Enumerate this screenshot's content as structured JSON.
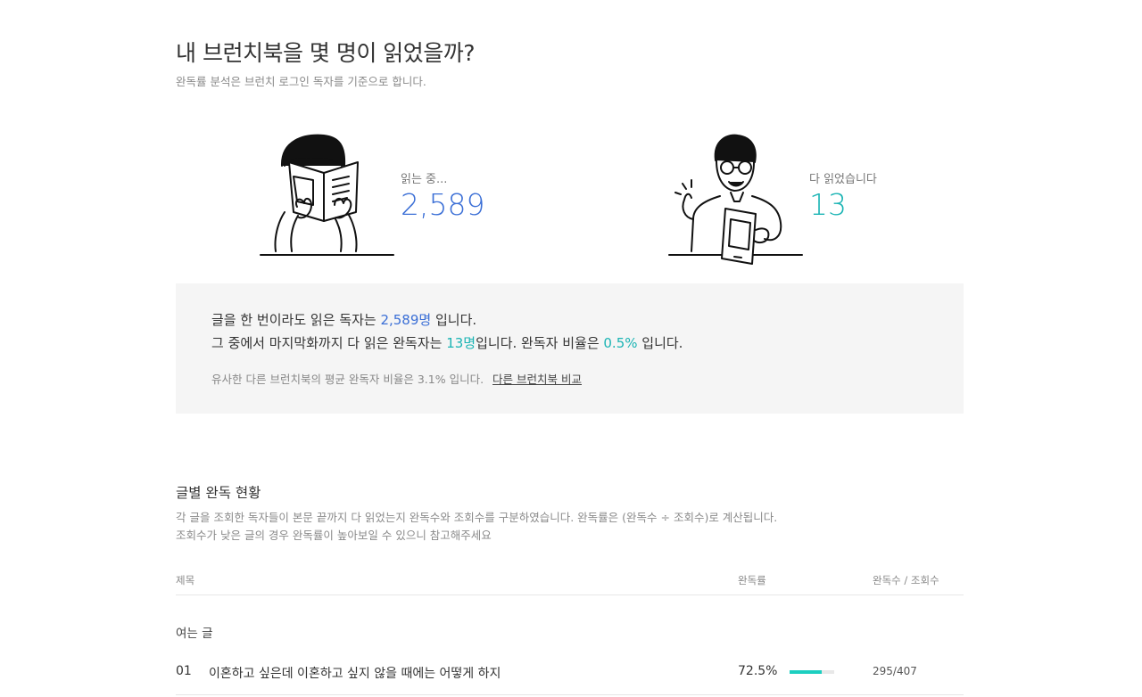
{
  "header": {
    "title": "내 브런치북을 몇 명이 읽었을까?",
    "subtitle": "완독률 분석은 브런치 로그인 독자를 기준으로 합니다."
  },
  "stats": {
    "reading": {
      "label": "읽는 중...",
      "value": "2,589",
      "color": "#3b6fd6"
    },
    "finished": {
      "label": "다 읽었습니다",
      "value": "13",
      "color": "#1ab4b4"
    }
  },
  "summary": {
    "line1_prefix": "글을 한 번이라도 읽은 독자는 ",
    "line1_value": "2,589명",
    "line1_suffix": " 입니다.",
    "line2_prefix": "그 중에서 마지막화까지 다 읽은 완독자는 ",
    "line2_value": "13명",
    "line2_mid": "입니다. 완독자 비율은 ",
    "line2_ratio": "0.5%",
    "line2_suffix": " 입니다.",
    "note": "유사한 다른 브런치북의 평균 완독자 비율은 3.1% 입니다.",
    "compare_link": "다른 브런치북 비교"
  },
  "section": {
    "title": "글별 완독 현황",
    "desc_line1": "각 글을 조회한 독자들이 본문 끝까지 다 읽었는지 완독수와 조회수를 구분하였습니다. 완독률은 (완독수 ÷ 조회수)로 계산됩니다.",
    "desc_line2": "조회수가 낮은 글의 경우 완독률이 높아보일 수 있으니 참고해주세요"
  },
  "table": {
    "headers": {
      "title": "제목",
      "rate": "완독률",
      "counts": "완독수 / 조회수"
    },
    "group_label": "여는 글",
    "rows": [
      {
        "num": "01",
        "title": "이혼하고 싶은데 이혼하고 싶지 않을 때에는 어떻게 하지",
        "rate": "72.5%",
        "rate_fraction": 0.725,
        "counts": "295/407"
      }
    ]
  },
  "colors": {
    "accent_blue": "#3b6fd6",
    "accent_teal": "#1ab4b4",
    "bar_fill": "#1ccfc0"
  },
  "icons": {
    "reader_illustration": "person-reading-book-icon",
    "finisher_illustration": "person-holding-book-icon"
  }
}
